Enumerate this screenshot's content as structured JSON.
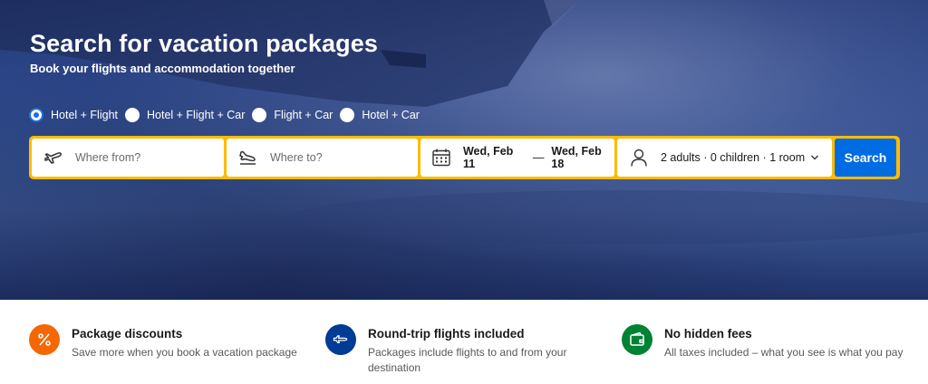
{
  "hero": {
    "title": "Search for vacation packages",
    "subtitle": "Book your flights and accommodation together"
  },
  "package_types": [
    {
      "label": "Hotel + Flight",
      "selected": true
    },
    {
      "label": "Hotel + Flight + Car",
      "selected": false
    },
    {
      "label": "Flight + Car",
      "selected": false
    },
    {
      "label": "Hotel + Car",
      "selected": false
    }
  ],
  "search": {
    "from_placeholder": "Where from?",
    "to_placeholder": "Where to?",
    "check_in": "Wed, Feb 11",
    "date_separator": "—",
    "check_out": "Wed, Feb 18",
    "guests": "2 adults · 0 children · 1 room",
    "button_label": "Search"
  },
  "features": [
    {
      "icon": "percent-icon",
      "color": "#f56700",
      "title": "Package discounts",
      "desc": "Save more when you book a vacation package"
    },
    {
      "icon": "airplane-icon",
      "color": "#003b95",
      "title": "Round-trip flights included",
      "desc": "Packages include flights to and from your destination"
    },
    {
      "icon": "wallet-icon",
      "color": "#008234",
      "title": "No hidden fees",
      "desc": "All taxes included – what you see is what you pay"
    }
  ],
  "colors": {
    "accent_yellow": "#febb02",
    "primary_blue": "#006ce4",
    "radio_selected": "#1a6ee6"
  }
}
